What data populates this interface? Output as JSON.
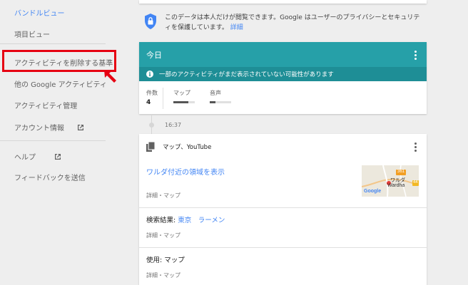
{
  "sidebar": {
    "items": [
      {
        "label": "バンドルビュー",
        "active": true
      },
      {
        "label": "項目ビュー"
      },
      {
        "label": "アクティビティを削除する基準"
      },
      {
        "label": "他の Google アクティビティ"
      },
      {
        "label": "アクティビティ管理"
      },
      {
        "label": "アカウント情報",
        "external": true
      },
      {
        "label": "ヘルプ",
        "external": true
      },
      {
        "label": "フィードバックを送信"
      }
    ]
  },
  "privacy": {
    "text": "このデータは本人だけが閲覧できます。Google はユーザーのプライバシーとセキュリティを保護しています。",
    "link": "詳細"
  },
  "today": {
    "title": "今日",
    "notice": "一部のアクティビティがまだ表示されていない可能性があります",
    "stats": [
      {
        "label": "件数",
        "value": "4"
      },
      {
        "label": "マップ",
        "level": 0.7
      },
      {
        "label": "音声",
        "level": 0.25
      }
    ]
  },
  "timeline": {
    "time": "16:37"
  },
  "activity": {
    "header": "マップ、YouTube",
    "item1": {
      "title": "ワルダ付近の領域を表示",
      "meta": "詳細・マップ"
    },
    "map_thumb": {
      "road_badge": "361",
      "road_badge2": "44",
      "city_ja": "ワルダ",
      "city_en": "Wardha",
      "logo": "Google"
    },
    "item2": {
      "prefix": "検索結果: ",
      "query1": "東京",
      "query2": "ラーメン",
      "meta": "詳細・マップ"
    },
    "item3": {
      "text": "使用: マップ",
      "meta": "詳細・マップ"
    }
  },
  "colors": {
    "accent": "#4285f4",
    "today_header": "#26a0a8",
    "today_notice": "#1e8e96",
    "highlight": "#e60012"
  }
}
